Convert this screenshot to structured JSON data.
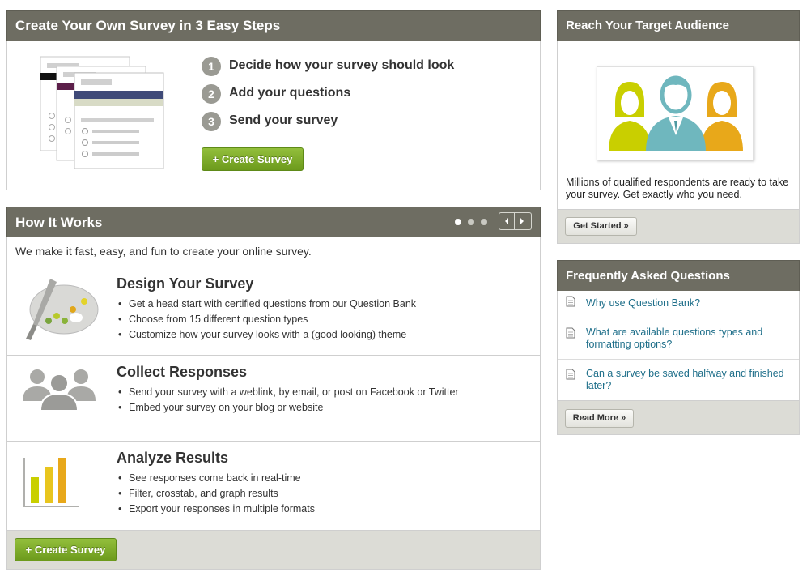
{
  "create_panel": {
    "title": "Create Your Own Survey in 3 Easy Steps",
    "steps": [
      {
        "num": "1",
        "label": "Decide how your survey should look"
      },
      {
        "num": "2",
        "label": "Add your questions"
      },
      {
        "num": "3",
        "label": "Send your survey"
      }
    ],
    "button_label": "+ Create Survey"
  },
  "how_it_works": {
    "title": "How It Works",
    "intro": "We make it fast, easy, and fun to create your online survey.",
    "carousel": {
      "dots": 3,
      "active_dot": 1,
      "prev_icon": "chevron-left-icon",
      "next_icon": "chevron-right-icon"
    },
    "sections": [
      {
        "title": "Design Your Survey",
        "icon": "palette-icon",
        "bullets": [
          "Get a head start with certified questions from our Question Bank",
          "Choose from 15 different question types",
          "Customize how your survey looks with a (good looking) theme"
        ]
      },
      {
        "title": "Collect Responses",
        "icon": "people-icon",
        "bullets": [
          "Send your survey with a weblink, by email, or post on Facebook or Twitter",
          "Embed your survey on your blog or website"
        ]
      },
      {
        "title": "Analyze Results",
        "icon": "bar-chart-icon",
        "bullets": [
          "See responses come back in real-time",
          "Filter, crosstab, and graph results",
          "Export your responses in multiple formats"
        ]
      }
    ],
    "button_label": "+ Create Survey"
  },
  "audience": {
    "title": "Reach Your Target Audience",
    "description": "Millions of qualified respondents are ready to take your survey. Get exactly who you need.",
    "button_label": "Get Started »"
  },
  "faq": {
    "title": "Frequently Asked Questions",
    "items": [
      "Why use Question Bank?",
      "What are available questions types and formatting options?",
      "Can a survey be saved halfway and finished later?"
    ],
    "button_label": "Read More »"
  },
  "colors": {
    "header_bg": "#6e6d62",
    "accent_green": "#7dab28",
    "link_teal": "#1f6f8a",
    "figure_yellow_green": "#c9cf00",
    "figure_teal": "#6fb7be",
    "figure_orange": "#e8a81a"
  }
}
